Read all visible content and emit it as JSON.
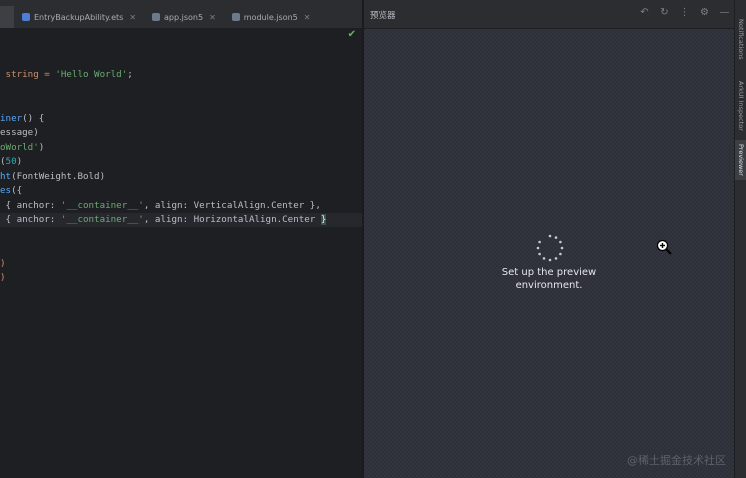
{
  "tabs": [
    {
      "label": "",
      "type": "ets",
      "active": true
    },
    {
      "label": "EntryBackupAbility.ets",
      "type": "ets",
      "active": false
    },
    {
      "label": "app.json5",
      "type": "json",
      "active": false
    },
    {
      "label": "module.json5",
      "type": "json",
      "active": false
    }
  ],
  "editor": {
    "lines": {
      "l1_a": " string = ",
      "l1_b": "'Hello World'",
      "l1_c": ";",
      "l2_a": "iner",
      "l2_b": "() {",
      "l3": "essage)",
      "l4_a": "oWorld'",
      "l4_b": ")",
      "l5_a": "(",
      "l5_b": "50",
      "l5_c": ")",
      "l6_a": "ht",
      "l6_b": "(FontWeight.Bold)",
      "l7_a": "es",
      "l7_b": "({",
      "l8_a": " { anchor: ",
      "l8_b": "'__container__'",
      "l8_c": ", align: VerticalAlign.Center },",
      "l9_a": " { anchor: ",
      "l9_b": "'__container__'",
      "l9_c": ", align: HorizontalAlign.Center ",
      "l9_d": "}",
      "l10": ")",
      "l11": ")"
    },
    "status_icon": "check-icon"
  },
  "preview": {
    "title": "预览器",
    "message_line1": "Set up the preview",
    "message_line2": "environment.",
    "header_icons": [
      "back-icon",
      "refresh-icon",
      "more-icon",
      "settings-icon",
      "minimize-icon"
    ],
    "watermark": "@稀土掘金技术社区"
  },
  "right_strip": {
    "items": [
      {
        "label": "Notifications",
        "active": false
      },
      {
        "label": "ArkUI Inspector",
        "active": false
      },
      {
        "label": "Previewer",
        "active": true
      }
    ]
  },
  "colors": {
    "editor_bg": "#1e1f22",
    "preview_bg": "#2d3038",
    "string": "#6aab73",
    "keyword": "#cf8e6d",
    "number": "#2aacb8",
    "ok_check": "#5fb865"
  }
}
